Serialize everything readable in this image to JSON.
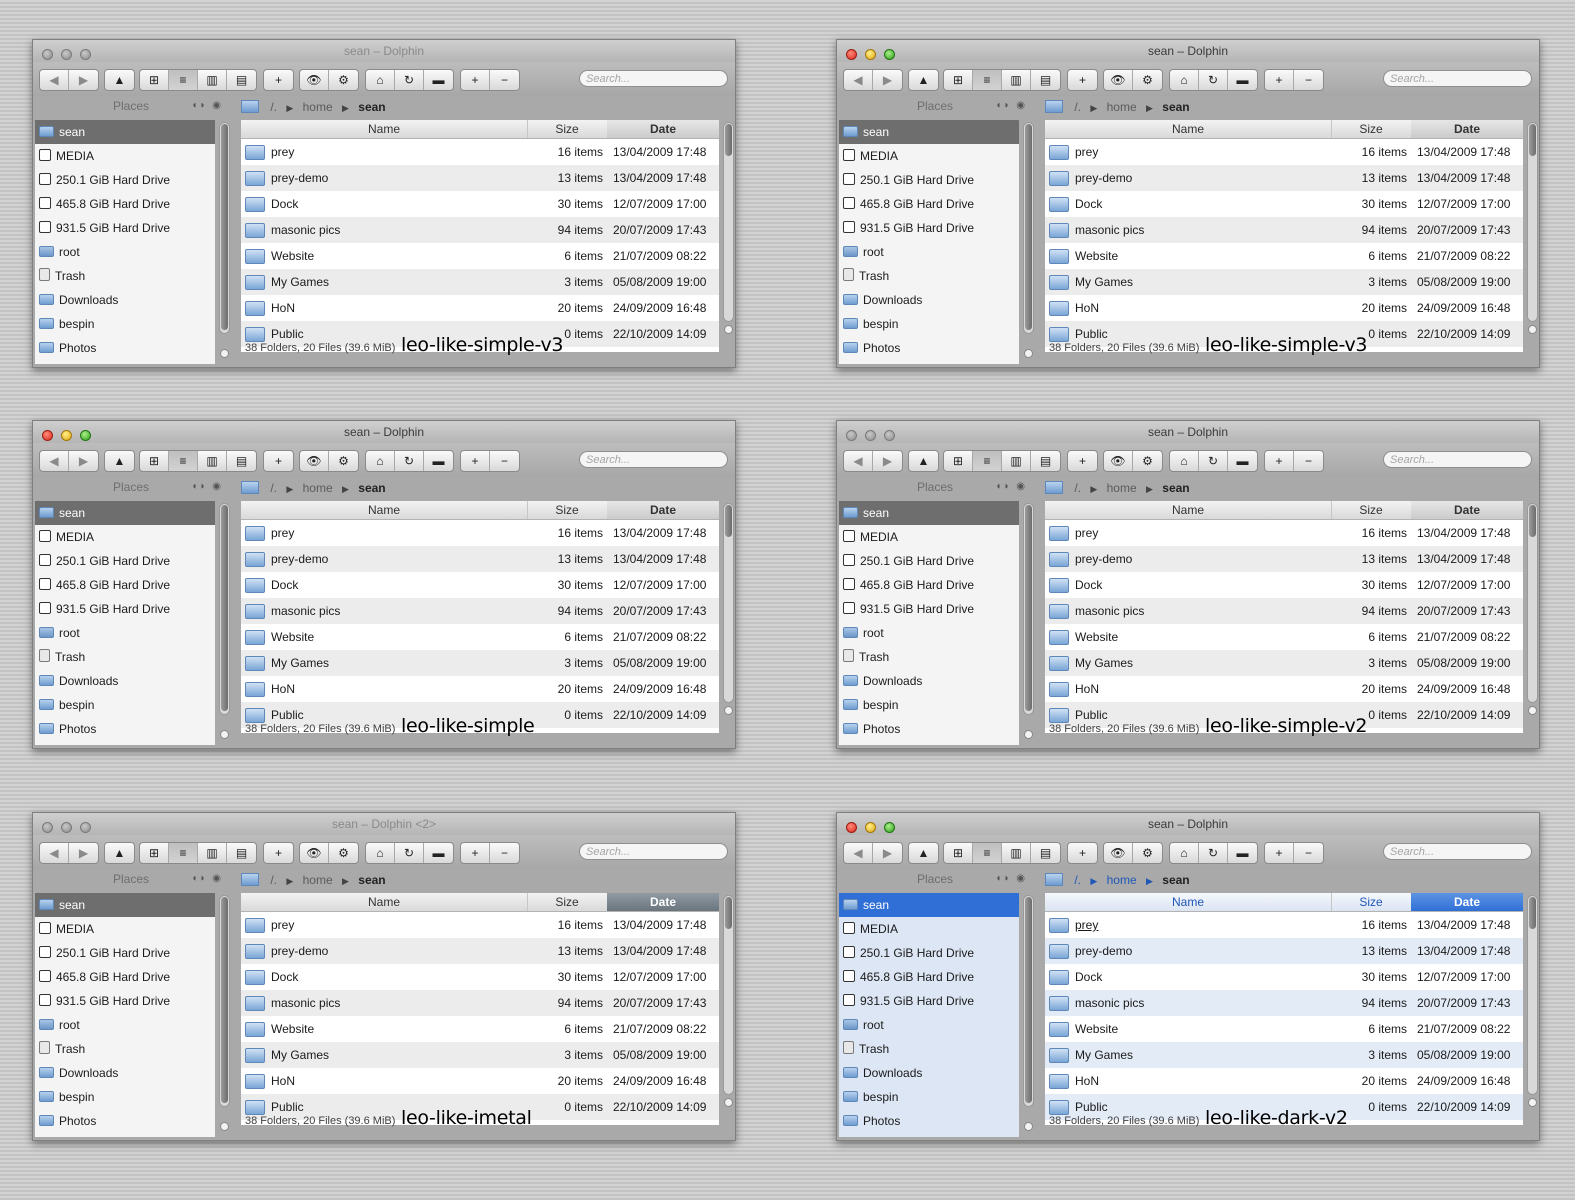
{
  "windows": [
    {
      "title": "sean – Dolphin",
      "theme": "leo-like-simple-v3"
    },
    {
      "title": "sean – Dolphin",
      "theme": "leo-like-simple-v3"
    },
    {
      "title": "sean – Dolphin",
      "theme": "leo-like-simple"
    },
    {
      "title": "sean – Dolphin",
      "theme": "leo-like-simple-v2"
    },
    {
      "title": "sean – Dolphin <2>",
      "theme": "leo-like-imetal"
    },
    {
      "title": "sean – Dolphin",
      "theme": "leo-like-dark-v2"
    }
  ],
  "toolbar": {
    "back": "◀",
    "forward": "▶",
    "up": "▲",
    "view_icons": "⊞",
    "view_details": "≡",
    "view_columns": "▥",
    "view_preview": "▤",
    "new": "+",
    "show": "👁",
    "settings": "⚙",
    "home": "⌂",
    "reload": "↻",
    "terminal": "▬",
    "zoom_in": "+",
    "zoom_out": "−",
    "search_placeholder": "Search..."
  },
  "places": {
    "header": "Places",
    "items": [
      {
        "label": "sean",
        "icon": "home-folder-icon"
      },
      {
        "label": "MEDIA",
        "icon": "drive-icon"
      },
      {
        "label": "250.1 GiB Hard Drive",
        "icon": "drive-icon"
      },
      {
        "label": "465.8 GiB Hard Drive",
        "icon": "drive-icon"
      },
      {
        "label": "931.5 GiB Hard Drive",
        "icon": "drive-icon"
      },
      {
        "label": "root",
        "icon": "root-folder-icon"
      },
      {
        "label": "Trash",
        "icon": "trash-icon"
      },
      {
        "label": "Downloads",
        "icon": "folder-icon"
      },
      {
        "label": "bespin",
        "icon": "folder-icon"
      },
      {
        "label": "Photos",
        "icon": "folder-icon"
      }
    ]
  },
  "breadcrumb": {
    "root": "/.",
    "home": "home",
    "current": "sean"
  },
  "columns": {
    "name": "Name",
    "size": "Size",
    "date": "Date"
  },
  "files": [
    {
      "name": "prey",
      "size": "16 items",
      "date": "13/04/2009 17:48"
    },
    {
      "name": "prey-demo",
      "size": "13 items",
      "date": "13/04/2009 17:48"
    },
    {
      "name": "Dock",
      "size": "30 items",
      "date": "12/07/2009 17:00"
    },
    {
      "name": "masonic pics",
      "size": "94 items",
      "date": "20/07/2009 17:43"
    },
    {
      "name": "Website",
      "size": "6 items",
      "date": "21/07/2009 08:22"
    },
    {
      "name": "My Games",
      "size": "3 items",
      "date": "05/08/2009 19:00"
    },
    {
      "name": "HoN",
      "size": "20 items",
      "date": "24/09/2009 16:48"
    },
    {
      "name": "Public",
      "size": "0 items",
      "date": "22/10/2009 14:09"
    }
  ],
  "status": "38 Folders, 20 Files (39.6 MiB)"
}
